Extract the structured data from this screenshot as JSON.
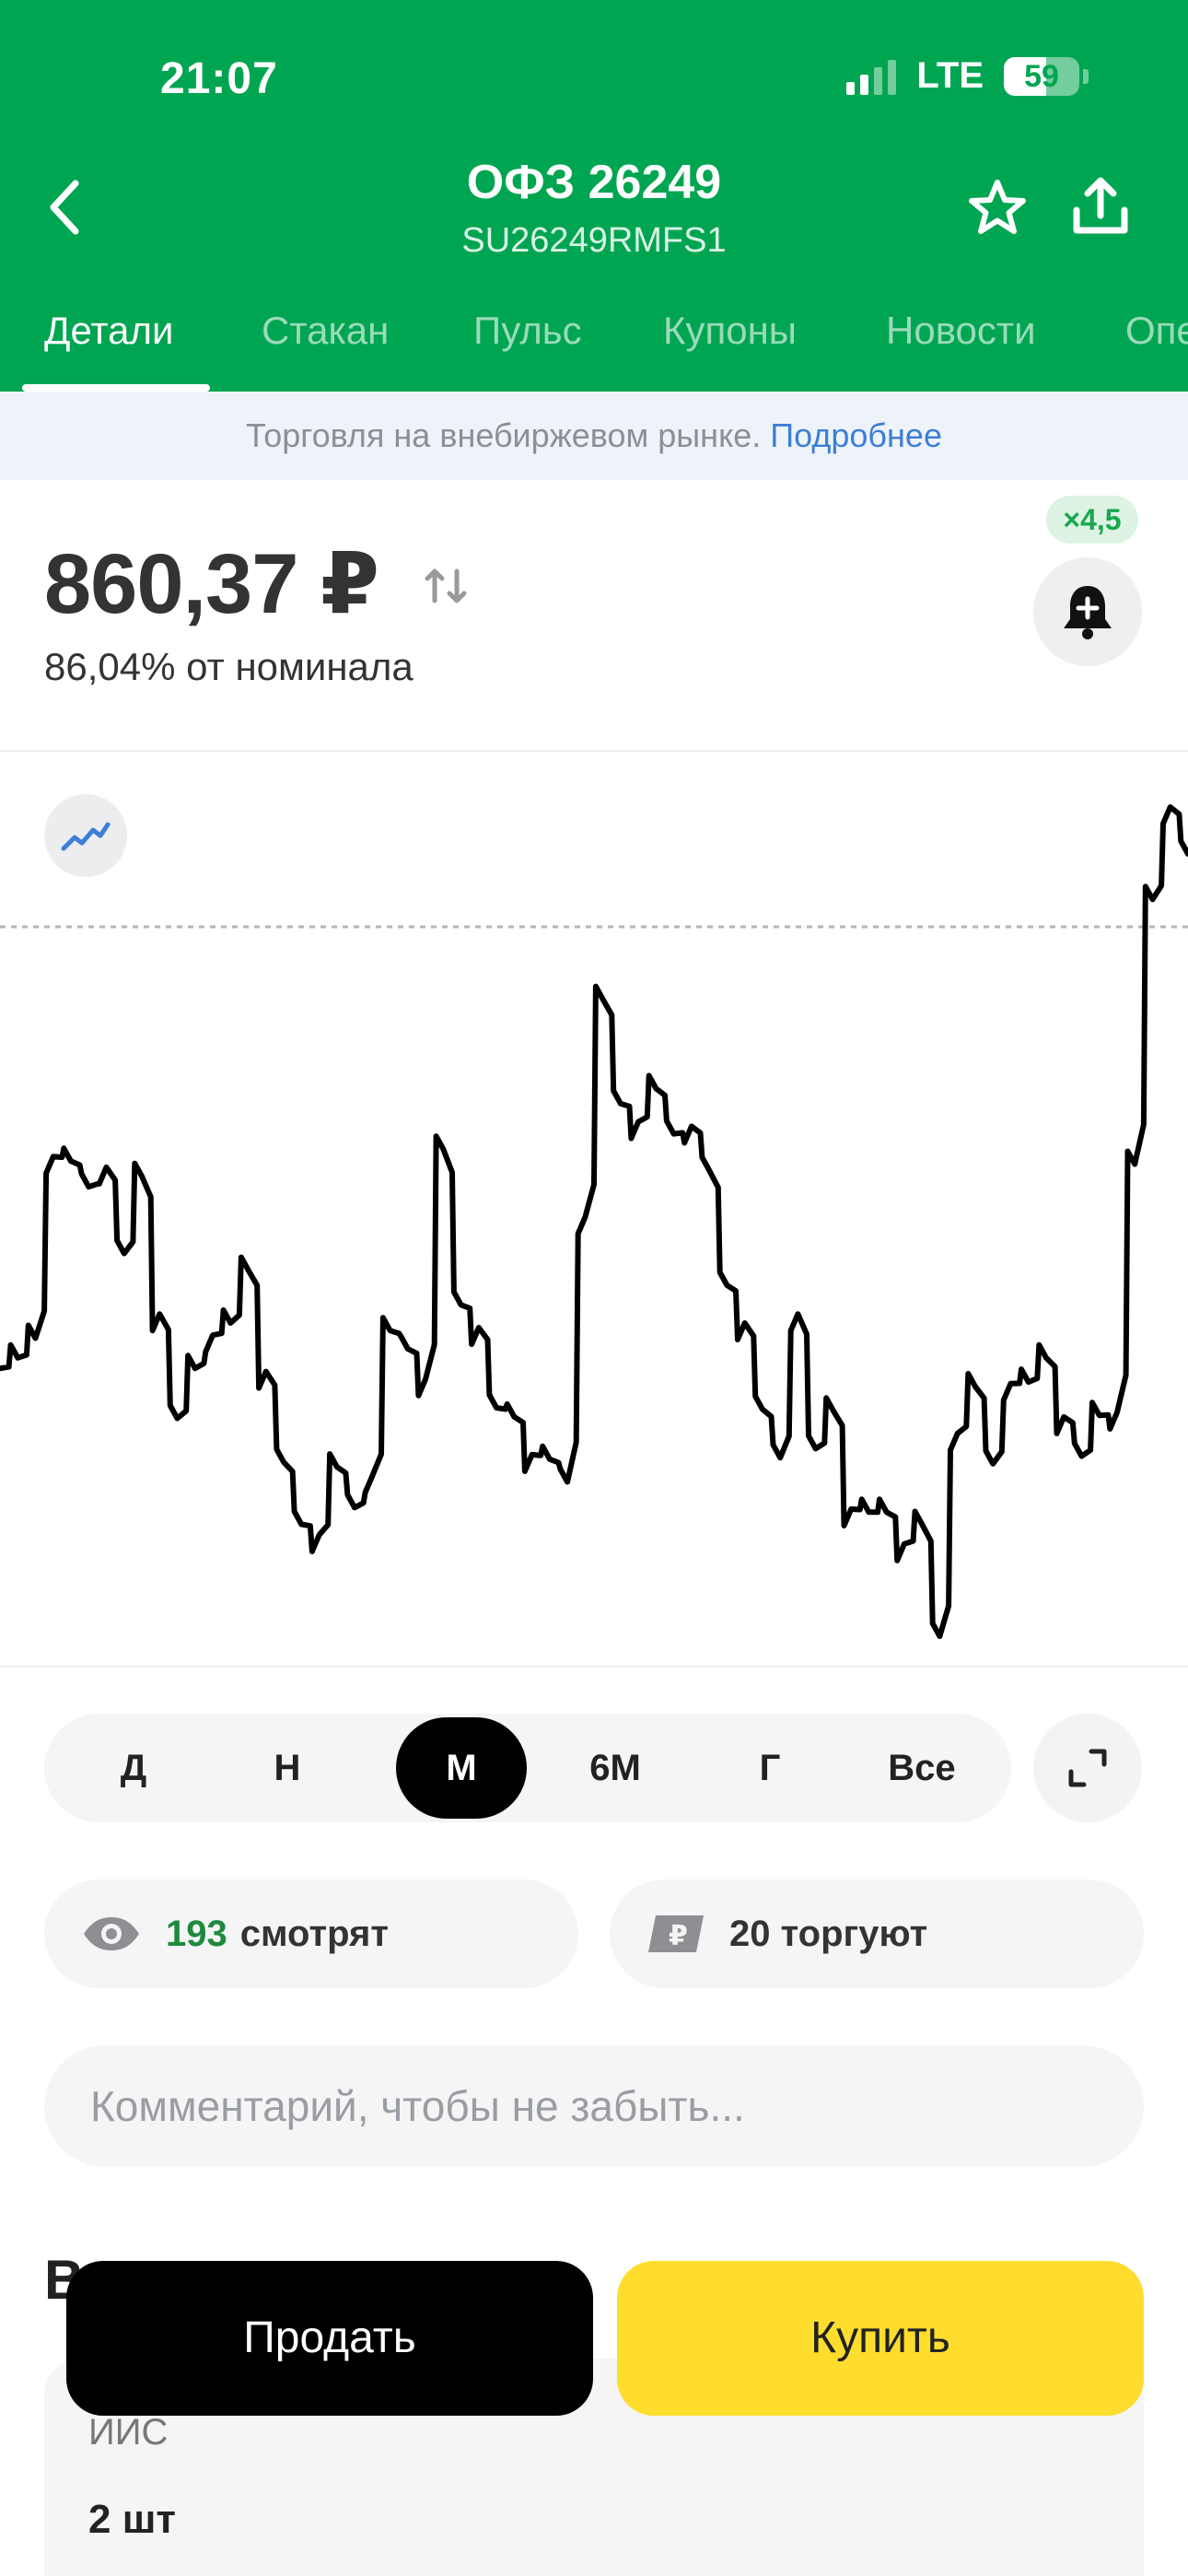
{
  "status_bar": {
    "time": "21:07",
    "network": "LTE",
    "battery": "59"
  },
  "header": {
    "title": "ОФЗ 26249",
    "subtitle": "SU26249RMFS1"
  },
  "tabs": [
    {
      "label": "Детали",
      "active": true
    },
    {
      "label": "Стакан",
      "active": false
    },
    {
      "label": "Пульс",
      "active": false
    },
    {
      "label": "Купоны",
      "active": false
    },
    {
      "label": "Новости",
      "active": false
    },
    {
      "label": "Опе",
      "active": false
    }
  ],
  "notice": {
    "text": "Торговля на внебиржевом рынке.",
    "link": "Подробнее"
  },
  "price": {
    "value": "860,37 ₽",
    "nominal": "86,04% от номинала",
    "leverage": "×4,5"
  },
  "chart": {
    "line_color": "#000000",
    "reference_line": "dashed",
    "relative_series": [
      1.85,
      1.92,
      2.05,
      3.25,
      3.22,
      3.05,
      3.18,
      2.61,
      3.12,
      2.21,
      1.52,
      1.85,
      2.07,
      2.15,
      2.5,
      1.83,
      1.23,
      0.82,
      0.75,
      1.2,
      0.93,
      1.14,
      2.1,
      1.98,
      1.78,
      3.3,
      2.27,
      2.12,
      1.59,
      1.53,
      1.28,
      1.25,
      1.1,
      2.85,
      4.29,
      3.6,
      3.48,
      3.7,
      3.4,
      3.45,
      3.16,
      2.4,
      2.15,
      1.58,
      1.26,
      2.21,
      1.32,
      1.57,
      0.92,
      0.9,
      0.9,
      0.69,
      0.82,
      0.08,
      1.42,
      1.73,
      1.22,
      1.75,
      1.76,
      1.92,
      1.53,
      1.27,
      1.54,
      1.56,
      3.2,
      4.95,
      5.56,
      5.25
    ]
  },
  "periods": [
    {
      "label": "Д",
      "active": false
    },
    {
      "label": "Н",
      "active": false
    },
    {
      "label": "М",
      "active": true
    },
    {
      "label": "6М",
      "active": false
    },
    {
      "label": "Г",
      "active": false
    },
    {
      "label": "Все",
      "active": false
    }
  ],
  "stats": {
    "watching_count": "193",
    "watching_label": "смотрят",
    "trading_label": "20 торгуют"
  },
  "comment": {
    "placeholder": "Комментарий, чтобы не забыть..."
  },
  "portfolio": {
    "title_visible": "В",
    "account": "ИИС",
    "quantity": "2 шт"
  },
  "actions": {
    "sell": "Продать",
    "buy": "Купить"
  },
  "colors": {
    "brand_green": "#00A551",
    "buy_yellow": "#FFDD2D",
    "link_blue": "#3D7FD6"
  },
  "icons": [
    "back-arrow-icon",
    "star-icon",
    "share-icon",
    "price-swap-icon",
    "bell-plus-icon",
    "line-chart-icon",
    "expand-icon",
    "eye-icon",
    "ruble-card-icon"
  ]
}
